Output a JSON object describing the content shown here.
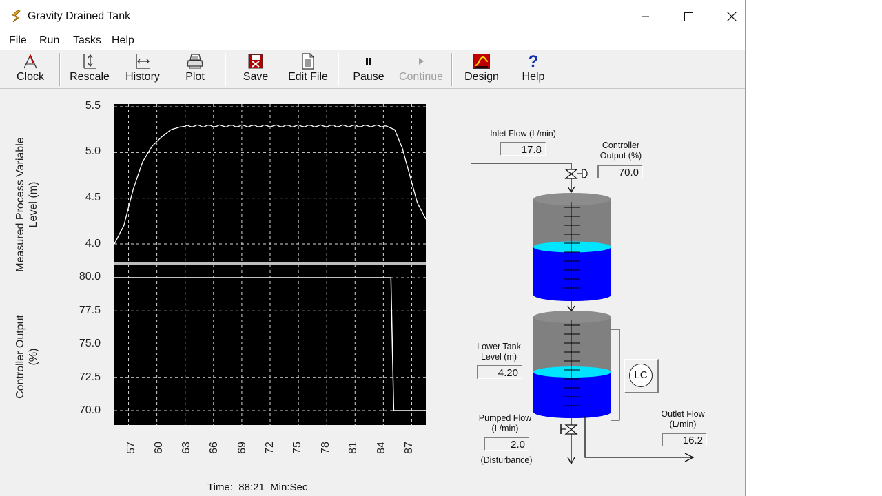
{
  "window": {
    "title": "Gravity Drained Tank",
    "controls": [
      "minimize-icon",
      "maximize-icon",
      "close-icon"
    ]
  },
  "menu": {
    "file": "File",
    "run": "Run",
    "tasks": "Tasks",
    "help": "Help"
  },
  "toolbar": {
    "clock": "Clock",
    "rescale": "Rescale",
    "history": "History",
    "plot": "Plot",
    "save": "Save",
    "edit_file": "Edit File",
    "pause": "Pause",
    "continue": "Continue",
    "design": "Design",
    "help": "Help"
  },
  "chart_data": [
    {
      "type": "line",
      "ylabel_line1": "Measured Process Variable",
      "ylabel_line2": "Level (m)",
      "yticks": [
        "5.5",
        "5.0",
        "4.5",
        "4.0"
      ],
      "ylim": [
        4.0,
        5.5
      ],
      "xlim": [
        55.5,
        88.5
      ],
      "grid": true,
      "background": "#000000",
      "line_color": "#ffffff",
      "series": [
        {
          "x": [
            55.5,
            56.5,
            57.5,
            58.5,
            59.5,
            60.5,
            61.5,
            62.5,
            63.5,
            65,
            67,
            69,
            71,
            73,
            75,
            77,
            79,
            81,
            83,
            84.3,
            85.2,
            86,
            86.8,
            87.6,
            88.5
          ],
          "y": [
            4.0,
            4.2,
            4.6,
            4.9,
            5.07,
            5.17,
            5.25,
            5.28,
            5.29,
            5.29,
            5.29,
            5.29,
            5.29,
            5.29,
            5.29,
            5.29,
            5.29,
            5.29,
            5.29,
            5.29,
            5.25,
            5.05,
            4.75,
            4.45,
            4.27
          ]
        }
      ]
    },
    {
      "type": "line",
      "ylabel_line1": "Controller Output",
      "ylabel_line2": "(%)",
      "yticks": [
        "80.0",
        "77.5",
        "75.0",
        "72.5",
        "70.0"
      ],
      "ylim": [
        70.0,
        80.0
      ],
      "xlim": [
        55.5,
        88.5
      ],
      "xticks": [
        "57",
        "60",
        "63",
        "66",
        "69",
        "72",
        "75",
        "78",
        "81",
        "84",
        "87"
      ],
      "grid": true,
      "background": "#000000",
      "line_color": "#ffffff",
      "series": [
        {
          "x": [
            55.5,
            84.8,
            85.1,
            88.5
          ],
          "y": [
            80.0,
            80.0,
            70.0,
            70.0
          ]
        }
      ]
    }
  ],
  "status": {
    "time_label": "Time:",
    "time_value": "88:21",
    "time_units": "Min:Sec"
  },
  "diagram": {
    "inlet_flow_label": "Inlet Flow  (L/min)",
    "inlet_flow_value": "17.8",
    "controller_output_label_1": "Controller",
    "controller_output_label_2": "Output  (%)",
    "controller_output_value": "70.0",
    "lower_tank_label_1": "Lower Tank",
    "lower_tank_label_2": "Level  (m)",
    "lower_tank_value": "4.20",
    "pumped_flow_label_1": "Pumped Flow",
    "pumped_flow_label_2": "(L/min)",
    "pumped_flow_value": "2.0",
    "disturbance_label": "(Disturbance)",
    "outlet_flow_label_1": "Outlet Flow",
    "outlet_flow_label_2": "(L/min)",
    "outlet_flow_value": "16.2",
    "lc_label": "LC",
    "upper_tank_fill_fraction": 0.5,
    "lower_tank_fill_fraction": 0.42,
    "tank_color_empty": "#808080",
    "tank_color_liquid": "#0000ff",
    "tank_color_surface": "#00e5ff"
  }
}
